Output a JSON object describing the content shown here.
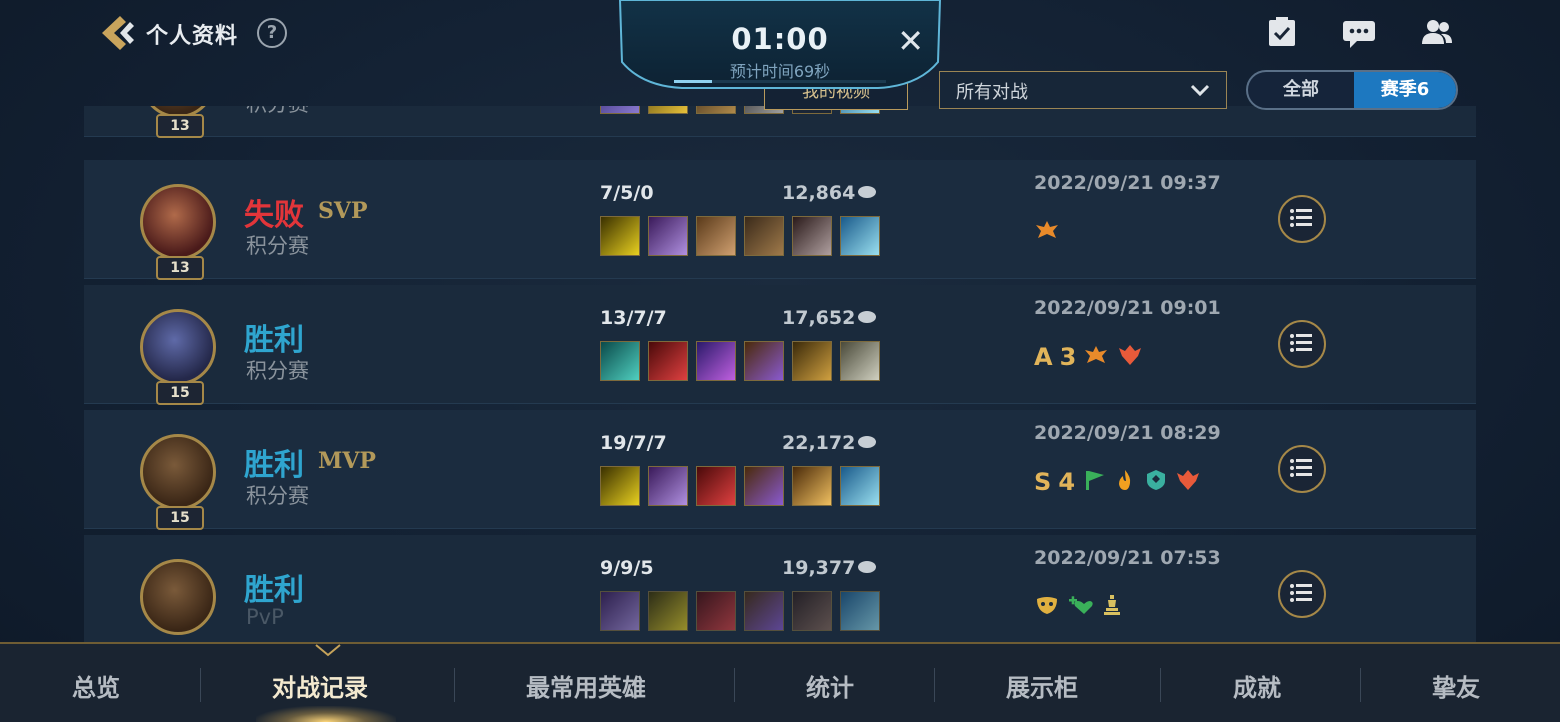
{
  "header": {
    "title": "个人资料",
    "help": "?"
  },
  "timer": {
    "time": "01:00",
    "estimate": "预计时间69秒",
    "close": "✕",
    "progress": 0.18
  },
  "toolbar": {
    "my_video": "我的视频",
    "filter_value": "所有对战",
    "season_toggle": [
      "全部",
      "赛季6"
    ],
    "season_selected": 1
  },
  "matches": [
    {
      "result": "失败",
      "result_type": "loss",
      "badge": "SVP",
      "mode": "积分赛",
      "level": "13",
      "kda": "7/5/0",
      "gold": "12,864",
      "date": "2022/09/21 09:37",
      "tags": [
        {
          "icon": "winged-emblem-icon"
        }
      ]
    },
    {
      "result": "胜利",
      "result_type": "win",
      "badge": "",
      "mode": "积分赛",
      "level": "15",
      "kda": "13/7/7",
      "gold": "17,652",
      "date": "2022/09/21 09:01",
      "tags": [
        {
          "text": "A"
        },
        {
          "text": "3"
        },
        {
          "icon": "winged-emblem-icon"
        },
        {
          "icon": "dragon-emblem-icon"
        }
      ]
    },
    {
      "result": "胜利",
      "result_type": "win",
      "badge": "MVP",
      "mode": "积分赛",
      "level": "15",
      "kda": "19/7/7",
      "gold": "22,172",
      "date": "2022/09/21 08:29",
      "tags": [
        {
          "text": "S"
        },
        {
          "text": "4"
        },
        {
          "icon": "flag-icon"
        },
        {
          "icon": "fire-icon"
        },
        {
          "icon": "shield-icon"
        },
        {
          "icon": "dragon-emblem-icon"
        }
      ]
    },
    {
      "result": "胜利",
      "result_type": "win",
      "badge": "",
      "mode": "PvP",
      "level": "",
      "kda": "9/9/5",
      "gold": "19,377",
      "date": "2022/09/21 07:53",
      "tags": [
        {
          "icon": "mask-icon"
        },
        {
          "icon": "heal-icon"
        },
        {
          "icon": "chess-icon"
        }
      ]
    }
  ],
  "partial_top_row": {
    "mode": "积分赛",
    "level": "13"
  },
  "bottom_nav": [
    "总览",
    "对战记录",
    "最常用英雄",
    "统计",
    "展示柜",
    "成就",
    "挚友"
  ],
  "bottom_nav_active": 1,
  "colors": {
    "win": "#2fa5cf",
    "loss": "#e2353a",
    "gold_accent": "#a58848",
    "season_active": "#1d78c0"
  }
}
